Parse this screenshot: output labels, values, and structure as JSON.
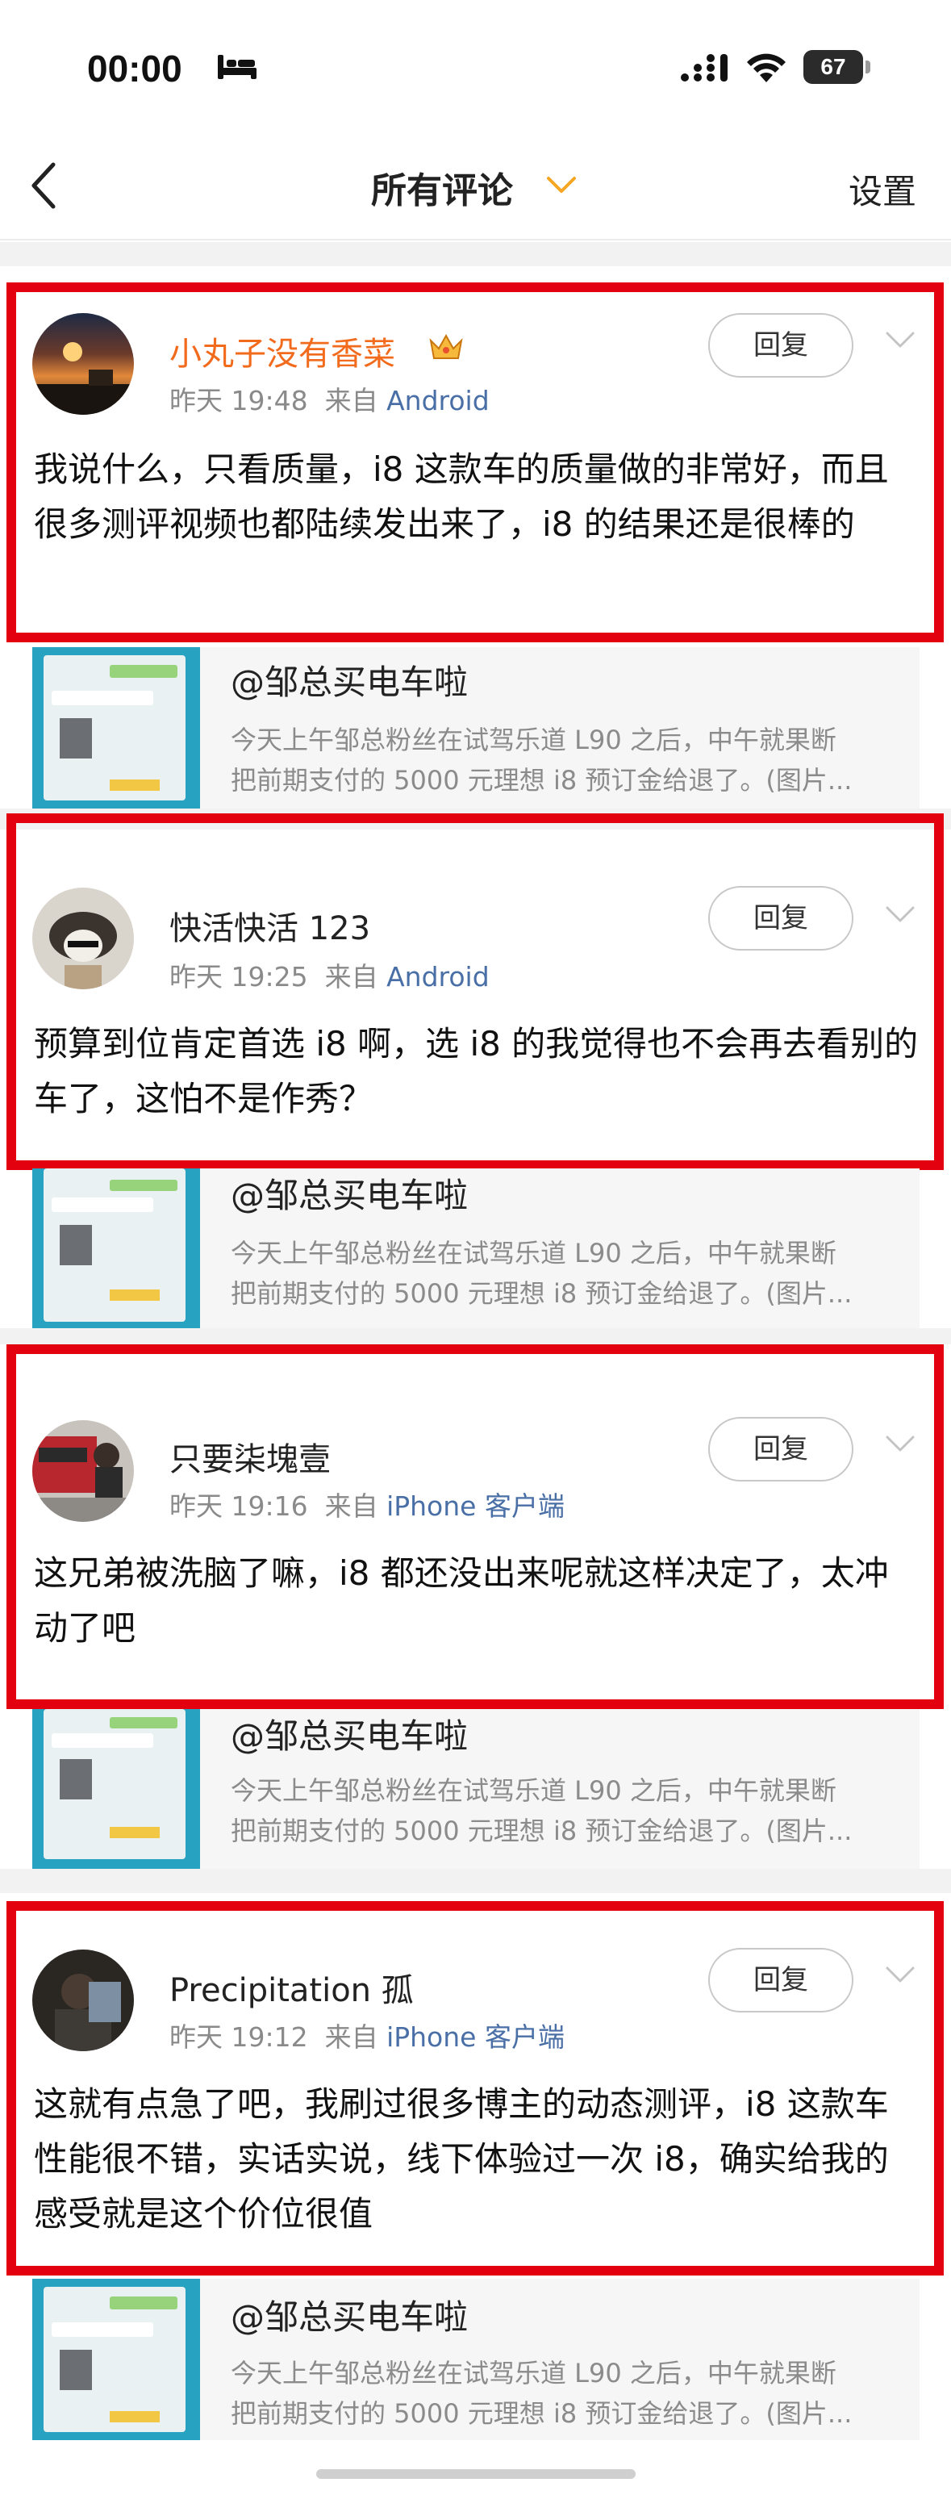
{
  "status_bar": {
    "time": "00:00",
    "battery_level": "67",
    "icons": [
      "bed-icon",
      "cellular-signal-icon",
      "wifi-icon",
      "battery-icon"
    ]
  },
  "nav": {
    "title": "所有评论",
    "settings_label": "设置",
    "icons": [
      "back-arrow-icon",
      "chevron-down-icon"
    ],
    "accent_color": "#f5a623"
  },
  "colors": {
    "highlight_border": "#e3000f",
    "vip_username": "#f26b1d",
    "source_link": "#496fa6"
  },
  "comments": [
    {
      "username": "小丸子没有香菜",
      "vip": true,
      "time": "昨天 19:48",
      "source_prefix": "来自",
      "source": "Android",
      "reply_label": "回复",
      "text": "我说什么，只看质量，i8 这款车的质量做的非常好，而且很多测评视频也都陆续发出来了，i8 的结果还是很棒的",
      "quote": {
        "author": "@邹总买电车啦",
        "line1": "今天上午邹总粉丝在试驾乐道 L90 之后，中午就果断",
        "line2": "把前期支付的 5000 元理想 i8 预订金给退了。(图片..."
      }
    },
    {
      "username": "快活快活 123",
      "vip": false,
      "time": "昨天 19:25",
      "source_prefix": "来自",
      "source": "Android",
      "reply_label": "回复",
      "text": "预算到位肯定首选 i8 啊，选 i8 的我觉得也不会再去看别的车了，这怕不是作秀？",
      "quote": {
        "author": "@邹总买电车啦",
        "line1": "今天上午邹总粉丝在试驾乐道 L90 之后，中午就果断",
        "line2": "把前期支付的 5000 元理想 i8 预订金给退了。(图片..."
      }
    },
    {
      "username": "只要柒塊壹",
      "vip": false,
      "time": "昨天 19:16",
      "source_prefix": "来自",
      "source": "iPhone 客户端",
      "reply_label": "回复",
      "text": "这兄弟被洗脑了嘛，i8 都还没出来呢就这样决定了，太冲动了吧",
      "quote": {
        "author": "@邹总买电车啦",
        "line1": "今天上午邹总粉丝在试驾乐道 L90 之后，中午就果断",
        "line2": "把前期支付的 5000 元理想 i8 预订金给退了。(图片..."
      }
    },
    {
      "username": "Precipitation 孤",
      "vip": false,
      "time": "昨天 19:12",
      "source_prefix": "来自",
      "source": "iPhone 客户端",
      "reply_label": "回复",
      "text": "这就有点急了吧，我刷过很多博主的动态测评，i8 这款车性能很不错，实话实说，线下体验过一次 i8，确实给我的感受就是这个价位很值",
      "quote": {
        "author": "@邹总买电车啦",
        "line1": "今天上午邹总粉丝在试驾乐道 L90 之后，中午就果断",
        "line2": "把前期支付的 5000 元理想 i8 预订金给退了。(图片..."
      }
    }
  ]
}
